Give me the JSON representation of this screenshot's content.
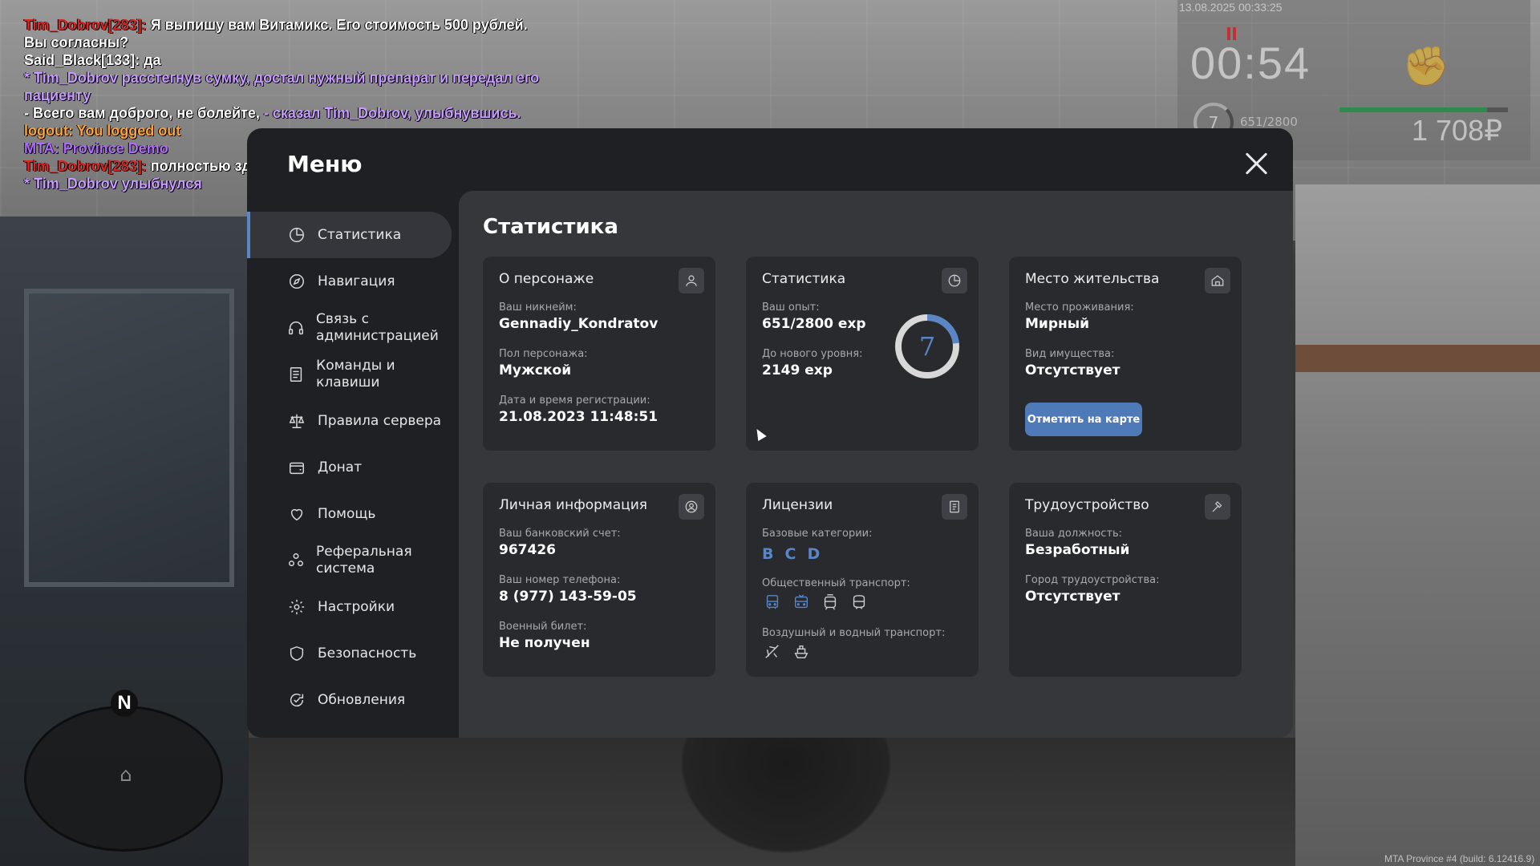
{
  "hud": {
    "datetime": "13.08.2025 00:33:25",
    "time": "00:54",
    "level": "7",
    "exp": "651/2800",
    "exp_fraction": 0.23,
    "money": "1 708₽"
  },
  "chat": [
    [
      {
        "t": "Tim_Dobrov[283]: ",
        "c": "c-red"
      },
      {
        "t": "Я выпишу вам Витамикс. Его стоимость 500 рублей.",
        "c": "c-white"
      }
    ],
    [
      {
        "t": " Вы согласны?",
        "c": "c-white"
      }
    ],
    [
      {
        "t": "Said_Black[133]: да",
        "c": "c-white"
      }
    ],
    [
      {
        "t": "* Tim_Dobrov расстегнув сумку, достал нужный препарат и передал его",
        "c": "c-purple"
      }
    ],
    [
      {
        "t": "пациенту",
        "c": "c-purple"
      }
    ],
    [
      {
        "t": "- Всего вам доброго, не болейте, ",
        "c": "c-white"
      },
      {
        "t": "- сказал Tim_Dobrov, улыбнувшись.",
        "c": "c-purple"
      }
    ],
    [
      {
        "t": "logout: You logged out",
        "c": "c-orange"
      }
    ],
    [
      {
        "t": "MTA: Province Demo",
        "c": "c-violet"
      }
    ],
    [
      {
        "t": "Tim_Dobrov[283]: ",
        "c": "c-red"
      },
      {
        "t": "полностью здоров.",
        "c": "c-white"
      }
    ],
    [
      {
        "t": "* Tim_Dobrov улыбнулся",
        "c": "c-purple"
      }
    ]
  ],
  "radar": {
    "north": "N"
  },
  "build": "MTA Province #4 (build: 6.12416.9)",
  "menu": {
    "title": "Меню",
    "sidebar": [
      {
        "label": "Статистика",
        "icon": "pie-chart-icon",
        "active": true
      },
      {
        "label": "Навигация",
        "icon": "compass-icon"
      },
      {
        "label": "Связь с администрацией",
        "icon": "headset-icon"
      },
      {
        "label": "Команды и клавиши",
        "icon": "document-icon"
      },
      {
        "label": "Правила сервера",
        "icon": "scales-icon"
      },
      {
        "label": "Донат",
        "icon": "wallet-icon"
      },
      {
        "label": "Помощь",
        "icon": "heart-hand-icon"
      },
      {
        "label": "Реферальная система",
        "icon": "people-icon"
      },
      {
        "label": "Настройки",
        "icon": "gear-icon"
      },
      {
        "label": "Безопасность",
        "icon": "shield-icon"
      },
      {
        "label": "Обновления",
        "icon": "refresh-check-icon"
      }
    ],
    "content_title": "Статистика",
    "cards": {
      "character": {
        "title": "О персонаже",
        "nickname_label": "Ваш никнейм:",
        "nickname": "Gennadiy_Kondratov",
        "gender_label": "Пол персонажа:",
        "gender": "Мужской",
        "reg_label": "Дата и время регистрации:",
        "reg": "21.08.2023 11:48:51"
      },
      "stats": {
        "title": "Статистика",
        "exp_label": "Ваш опыт:",
        "exp": "651/2800 exp",
        "next_label": "До нового уровня:",
        "next": "2149 exp",
        "level": "7",
        "progress": 0.2325
      },
      "residence": {
        "title": "Место жительства",
        "place_label": "Место проживания:",
        "place": "Мирный",
        "property_label": "Вид имущества:",
        "property": "Отсутствует",
        "button": "Отметить на карте"
      },
      "personal": {
        "title": "Личная информация",
        "bank_label": "Ваш банковский счет:",
        "bank": "967426",
        "phone_label": "Ваш номер телефона:",
        "phone": "8 (977) 143-59-05",
        "military_label": "Военный билет:",
        "military": "Не получен"
      },
      "licenses": {
        "title": "Лицензии",
        "base_label": "Базовые категории:",
        "base": [
          "B",
          "C",
          "D"
        ],
        "public_label": "Общественный транспорт:",
        "air_label": "Воздушный и водный транспорт:"
      },
      "employment": {
        "title": "Трудоустройство",
        "position_label": "Ваша должность:",
        "position": "Безработный",
        "city_label": "Город трудоустройства:",
        "city": "Отсутствует"
      }
    }
  },
  "colors": {
    "accent": "#5b86c5",
    "panel": "#1f2023",
    "content": "#35373b",
    "card": "#292a2e"
  }
}
